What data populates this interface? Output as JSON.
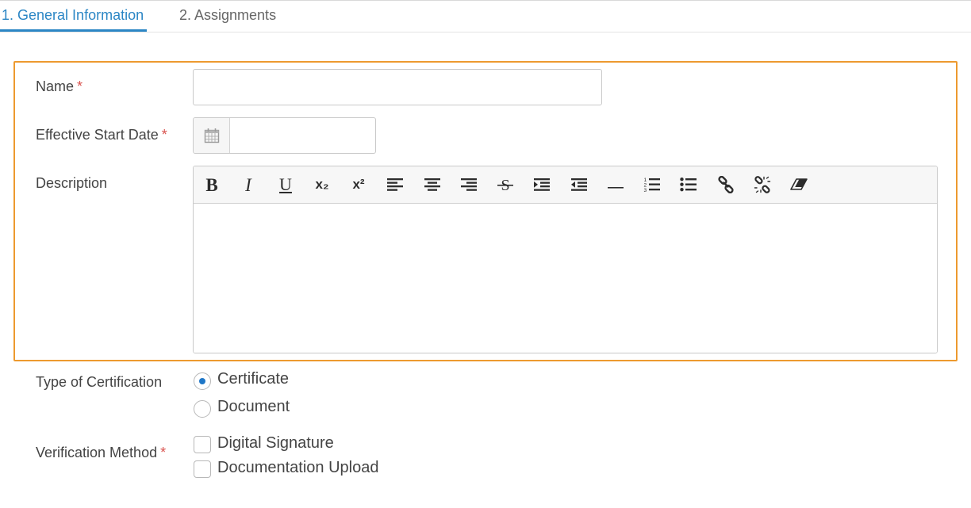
{
  "tabs": [
    {
      "label": "1. General Information",
      "active": true
    },
    {
      "label": "2. Assignments",
      "active": false
    }
  ],
  "form": {
    "name_label": "Name",
    "name_value": "",
    "start_date_label": "Effective Start Date",
    "start_date_value": "",
    "description_label": "Description",
    "required_mark": "*",
    "toolbar": {
      "bold": "B",
      "italic": "I",
      "underline": "U",
      "subscript": "x₂",
      "superscript": "x²"
    },
    "certification_type_label": "Type of Certification",
    "certification_options": [
      {
        "label": "Certificate",
        "selected": true
      },
      {
        "label": "Document",
        "selected": false
      }
    ],
    "verification_label": "Verification Method",
    "verification_options": [
      {
        "label": "Digital Signature",
        "checked": false
      },
      {
        "label": "Documentation Upload",
        "checked": false
      }
    ]
  },
  "colors": {
    "accent": "#2b86c5",
    "highlight_border": "#ed9a2f",
    "required": "#d9534f",
    "radio_selected": "#1f77c7"
  },
  "icons": [
    "calendar-icon",
    "bold-icon",
    "italic-icon",
    "underline-icon",
    "subscript-icon",
    "superscript-icon",
    "align-left-icon",
    "align-center-icon",
    "align-right-icon",
    "strikethrough-icon",
    "indent-icon",
    "outdent-icon",
    "horizontal-rule-icon",
    "ordered-list-icon",
    "unordered-list-icon",
    "link-icon",
    "unlink-icon",
    "eraser-icon"
  ]
}
